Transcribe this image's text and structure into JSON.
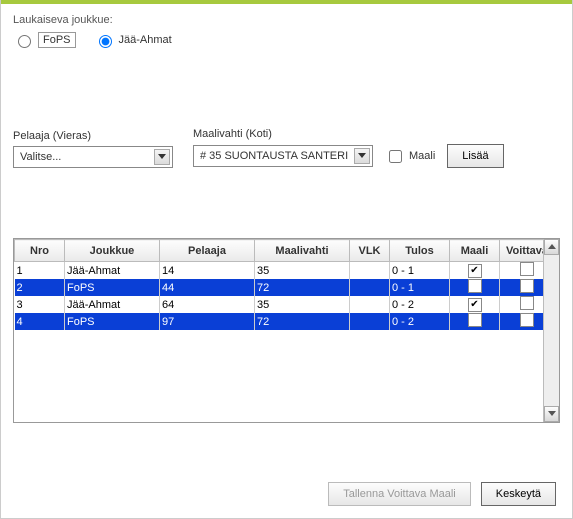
{
  "labels": {
    "shooting_team": "Laukaiseva joukkue:",
    "player_away": "Pelaaja (Vieras)",
    "goalie_home": "Maalivahti (Koti)",
    "goal": "Maali",
    "add": "Lisää",
    "save_winning": "Tallenna Voittava Maali",
    "abort": "Keskeytä"
  },
  "teams": {
    "opt1": "FoPS",
    "opt2": "Jää-Ahmat",
    "selected": "opt2"
  },
  "player_select": {
    "value": "Valitse..."
  },
  "goalie_select": {
    "value": "# 35 SUONTAUSTA SANTERI"
  },
  "goal_checked": false,
  "columns": {
    "nro": "Nro",
    "joukkue": "Joukkue",
    "pelaaja": "Pelaaja",
    "maalivahti": "Maalivahti",
    "vlk": "VLK",
    "tulos": "Tulos",
    "maali": "Maali",
    "voittava": "Voittava"
  },
  "rows": [
    {
      "nro": "1",
      "joukkue": "Jää-Ahmat",
      "pelaaja": "14",
      "maalivahti": "35",
      "vlk": "",
      "tulos": "0 - 1",
      "maali": true,
      "voittava": false,
      "sel": false
    },
    {
      "nro": "2",
      "joukkue": "FoPS",
      "pelaaja": "44",
      "maalivahti": "72",
      "vlk": "",
      "tulos": "0 - 1",
      "maali": false,
      "voittava": false,
      "sel": true
    },
    {
      "nro": "3",
      "joukkue": "Jää-Ahmat",
      "pelaaja": "64",
      "maalivahti": "35",
      "vlk": "",
      "tulos": "0 - 2",
      "maali": true,
      "voittava": false,
      "sel": false
    },
    {
      "nro": "4",
      "joukkue": "FoPS",
      "pelaaja": "97",
      "maalivahti": "72",
      "vlk": "",
      "tulos": "0 - 2",
      "maali": false,
      "voittava": false,
      "sel": true
    }
  ]
}
